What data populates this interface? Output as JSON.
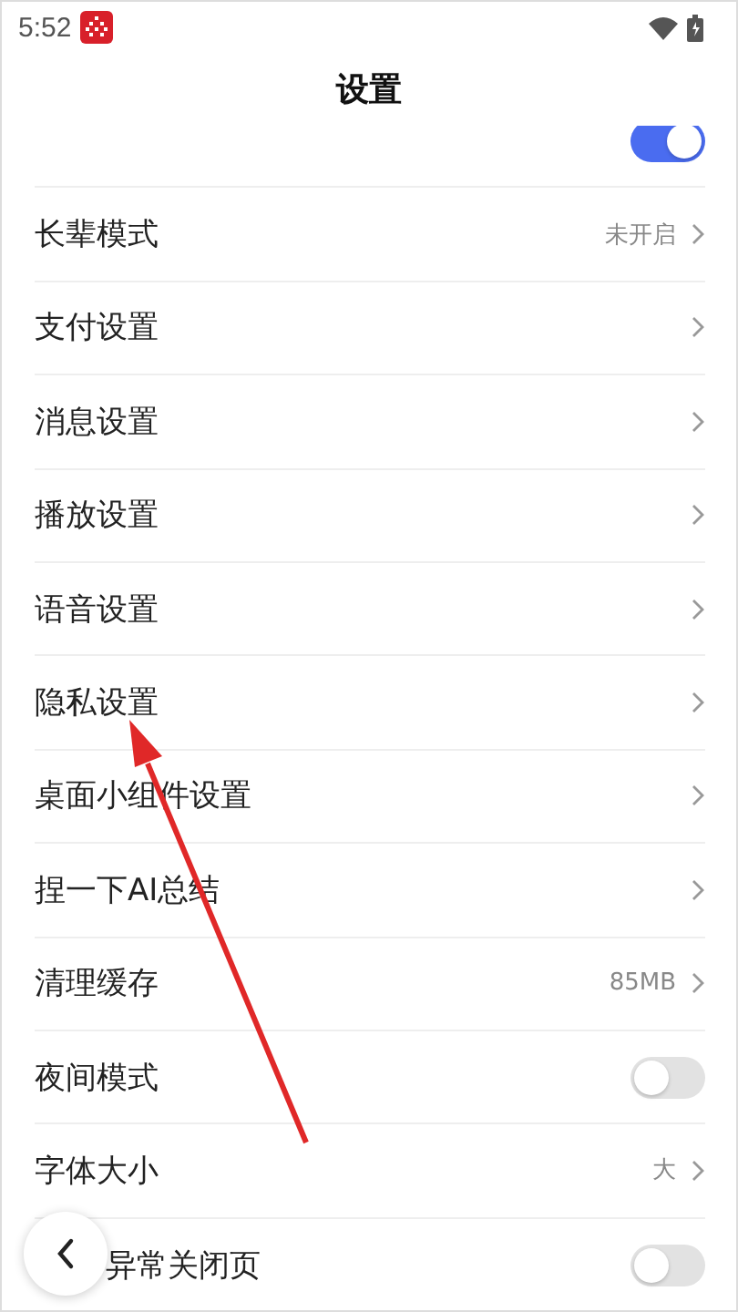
{
  "status_bar": {
    "time": "5:52"
  },
  "title": "设置",
  "rows": [
    {
      "kind": "toggle",
      "on": true
    },
    {
      "kind": "link",
      "label": "长辈模式",
      "value": "未开启"
    },
    {
      "kind": "link",
      "label": "支付设置"
    },
    {
      "kind": "link",
      "label": "消息设置"
    },
    {
      "kind": "link",
      "label": "播放设置"
    },
    {
      "kind": "link",
      "label": "语音设置"
    },
    {
      "kind": "link",
      "label": "隐私设置"
    },
    {
      "kind": "link",
      "label": "桌面小组件设置"
    },
    {
      "kind": "link",
      "label": "捏一下AI总结"
    },
    {
      "kind": "link",
      "label": "清理缓存",
      "value": "85MB"
    },
    {
      "kind": "toggle",
      "label": "夜间模式",
      "on": false
    },
    {
      "kind": "link",
      "label": "字体大小",
      "value": "大"
    },
    {
      "kind": "toggle",
      "label": "异常关闭页",
      "on": false
    }
  ]
}
